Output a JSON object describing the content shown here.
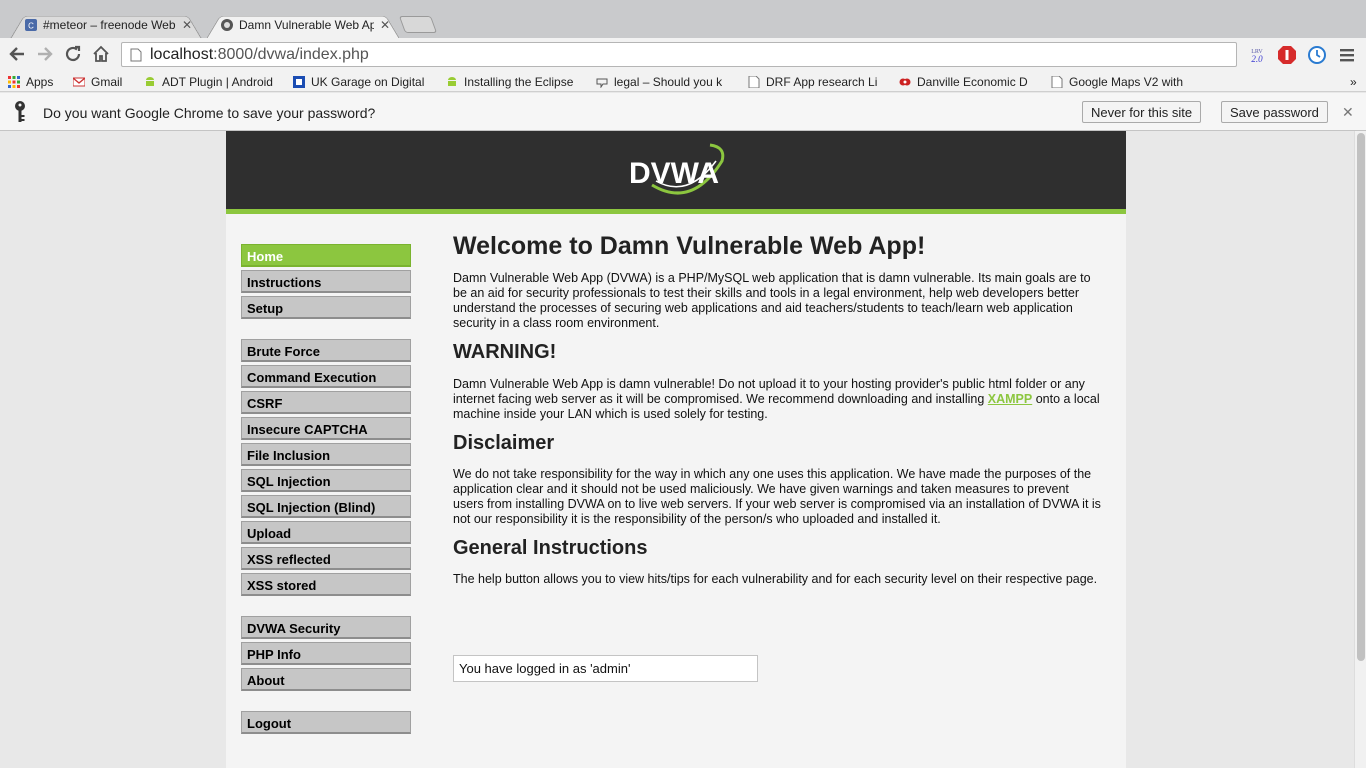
{
  "browser": {
    "tabs": [
      {
        "title": "#meteor – freenode Web IRC",
        "close": "✕"
      },
      {
        "title": "Damn Vulnerable Web App",
        "close": "✕"
      }
    ],
    "url_host": "localhost",
    "url_path": ":8000/dvwa/index.php",
    "extension_badge": "2.0",
    "bookmarks": [
      "Apps",
      "Gmail",
      "ADT Plugin | Android",
      "UK Garage on Digital",
      "Installing the Eclipse",
      "legal – Should you k",
      "DRF App research Li",
      "Danville Economic D",
      "Google Maps V2 with"
    ],
    "bookmarks_overflow": "»",
    "infobar": {
      "question": "Do you want Google Chrome to save your password?",
      "never_label": "Never for this site",
      "save_label": "Save password",
      "close": "✕"
    }
  },
  "dvwa": {
    "logo_text": "DVWA",
    "menu": {
      "group1": [
        "Home",
        "Instructions",
        "Setup"
      ],
      "group2": [
        "Brute Force",
        "Command Execution",
        "CSRF",
        "Insecure CAPTCHA",
        "File Inclusion",
        "SQL Injection",
        "SQL Injection (Blind)",
        "Upload",
        "XSS reflected",
        "XSS stored"
      ],
      "group3": [
        "DVWA Security",
        "PHP Info",
        "About"
      ],
      "group4": [
        "Logout"
      ]
    },
    "title": "Welcome to Damn Vulnerable Web App!",
    "intro": "Damn Vulnerable Web App (DVWA) is a PHP/MySQL web application that is damn vulnerable. Its main goals are to be an aid for security professionals to test their skills and tools in a legal environment, help web developers better understand the processes of securing web applications and aid teachers/students to teach/learn web application security in a class room environment.",
    "warning_heading": "WARNING!",
    "warning_text_before": "Damn Vulnerable Web App is damn vulnerable! Do not upload it to your hosting provider's public html folder or any internet facing web server as it will be compromised. We recommend downloading and installing ",
    "warning_link": "XAMPP",
    "warning_text_after": " onto a local machine inside your LAN which is used solely for testing.",
    "disclaimer_heading": "Disclaimer",
    "disclaimer_text": "We do not take responsibility for the way in which any one uses this application. We have made the purposes of the application clear and it should not be used maliciously. We have given warnings and taken measures to prevent users from installing DVWA on to live web servers. If your web server is compromised via an installation of DVWA it is not our responsibility it is the responsibility of the person/s who uploaded and installed it.",
    "general_heading": "General Instructions",
    "general_text": "The help button allows you to view hits/tips for each vulnerability and for each security level on their respective page.",
    "login_status": "You have logged in as 'admin'"
  },
  "colors": {
    "accent": "#8cc63f",
    "header_bg": "#2f2f2f",
    "menu_bg": "#c6c6c6"
  }
}
